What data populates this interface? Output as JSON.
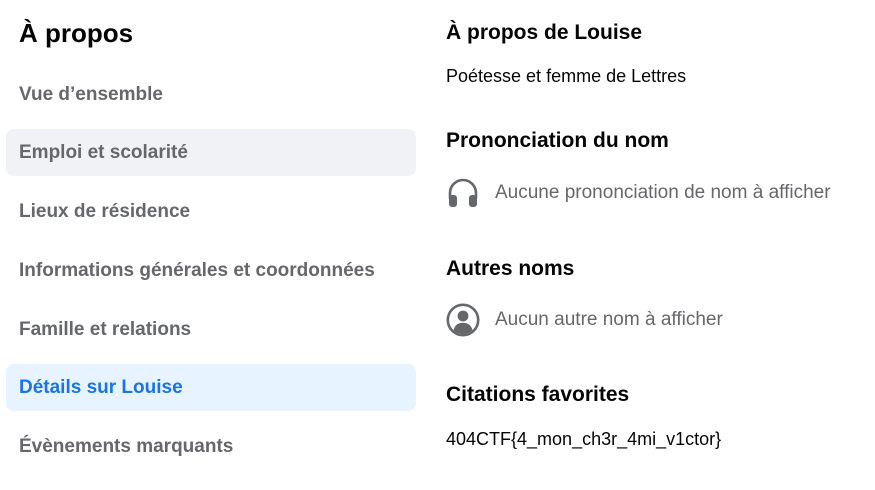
{
  "sidebar": {
    "title": "À propos",
    "items": [
      {
        "label": "Vue d’ensemble"
      },
      {
        "label": "Emploi et scolarité"
      },
      {
        "label": "Lieux de résidence"
      },
      {
        "label": "Informations générales et coordonnées"
      },
      {
        "label": "Famille et relations"
      },
      {
        "label": "Détails sur Louise"
      },
      {
        "label": "Évènements marquants"
      }
    ],
    "active_item": "Détails sur Louise",
    "hovered_item": "Emploi et scolarité"
  },
  "main": {
    "about": {
      "heading": "À propos de Louise",
      "text": "Poétesse et femme de Lettres"
    },
    "pronunciation": {
      "heading": "Prononciation du nom",
      "empty_text": "Aucune prononciation de nom à afficher",
      "icon": "headphones-icon"
    },
    "other_names": {
      "heading": "Autres noms",
      "empty_text": "Aucun autre nom à afficher",
      "icon": "person-circle-icon"
    },
    "quotes": {
      "heading": "Citations favorites",
      "text": "404CTF{4_mon_ch3r_4mi_v1ctor}"
    }
  },
  "colors": {
    "active_text": "#1b74e4",
    "active_bg": "#e7f3ff",
    "hover_bg": "#f0f2f5",
    "secondary_text": "#65676b",
    "primary_text": "#050505"
  }
}
